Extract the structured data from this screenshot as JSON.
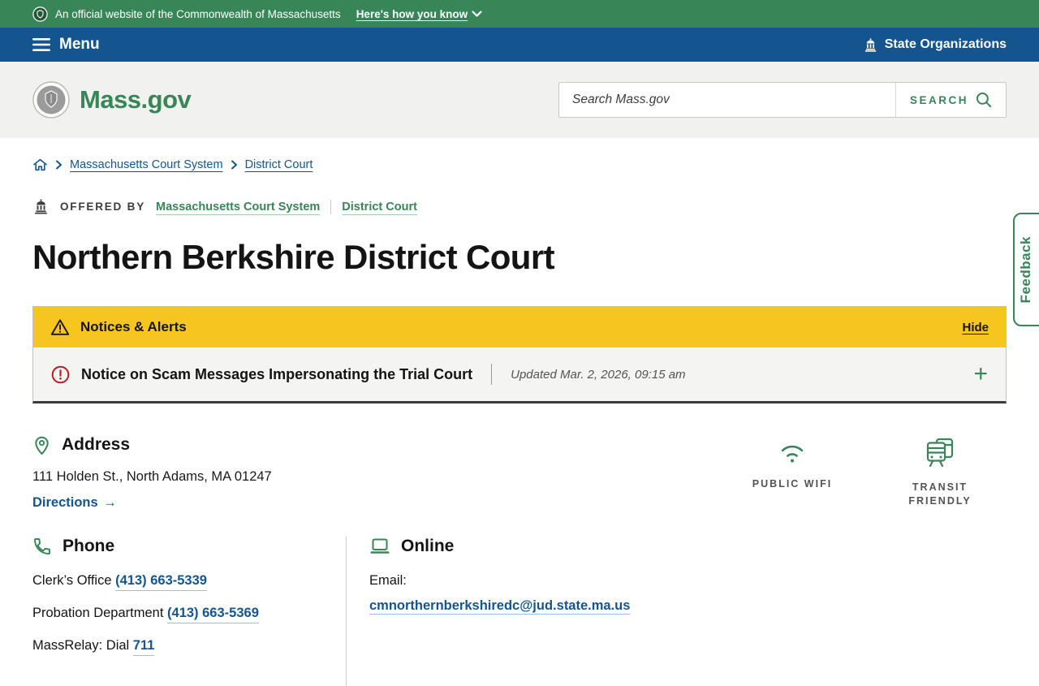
{
  "banner": {
    "official_text": "An official website of the Commonwealth of Massachusetts",
    "how_you_know": "Here's how you know"
  },
  "nav": {
    "menu_label": "Menu",
    "state_organizations_label": "State Organizations"
  },
  "header": {
    "logo_text": "Mass.gov",
    "search_placeholder": "Search Mass.gov",
    "search_button_label": "SEARCH"
  },
  "breadcrumb": {
    "items": [
      {
        "label": "Massachusetts Court System"
      },
      {
        "label": "District Court"
      }
    ]
  },
  "offered_by": {
    "label": "OFFERED BY",
    "links": [
      {
        "label": "Massachusetts Court System"
      },
      {
        "label": "District Court"
      }
    ]
  },
  "page": {
    "title": "Northern Berkshire District Court"
  },
  "alerts": {
    "header_title": "Notices & Alerts",
    "hide_label": "Hide",
    "notice": {
      "title": "Notice on Scam Messages Impersonating the Trial Court",
      "updated": "Updated Mar. 2, 2026, 09:15 am",
      "expand_symbol": "+"
    }
  },
  "address": {
    "heading": "Address",
    "line": "111 Holden St., North Adams, MA 01247",
    "directions_label": "Directions",
    "directions_arrow": "→"
  },
  "amenities": [
    {
      "label": "PUBLIC WIFI"
    },
    {
      "label": "TRANSIT FRIENDLY"
    }
  ],
  "phone": {
    "heading": "Phone",
    "rows": [
      {
        "label": "Clerk’s Office",
        "number": "(413) 663-5339"
      },
      {
        "label": "Probation Department",
        "number": "(413) 663-5369"
      },
      {
        "label": "MassRelay: Dial",
        "number": "711"
      }
    ]
  },
  "online": {
    "heading": "Online",
    "email_label": "Email:",
    "email": "cmnorthernberkshiredc@jud.state.ma.us"
  },
  "feedback": {
    "label": "Feedback"
  },
  "colors": {
    "green": "#388557",
    "blue": "#14558F",
    "alert_yellow": "#F6C51F",
    "notice_red": "#B51E23",
    "text_dark": "#141414",
    "text_gray": "#535353"
  }
}
